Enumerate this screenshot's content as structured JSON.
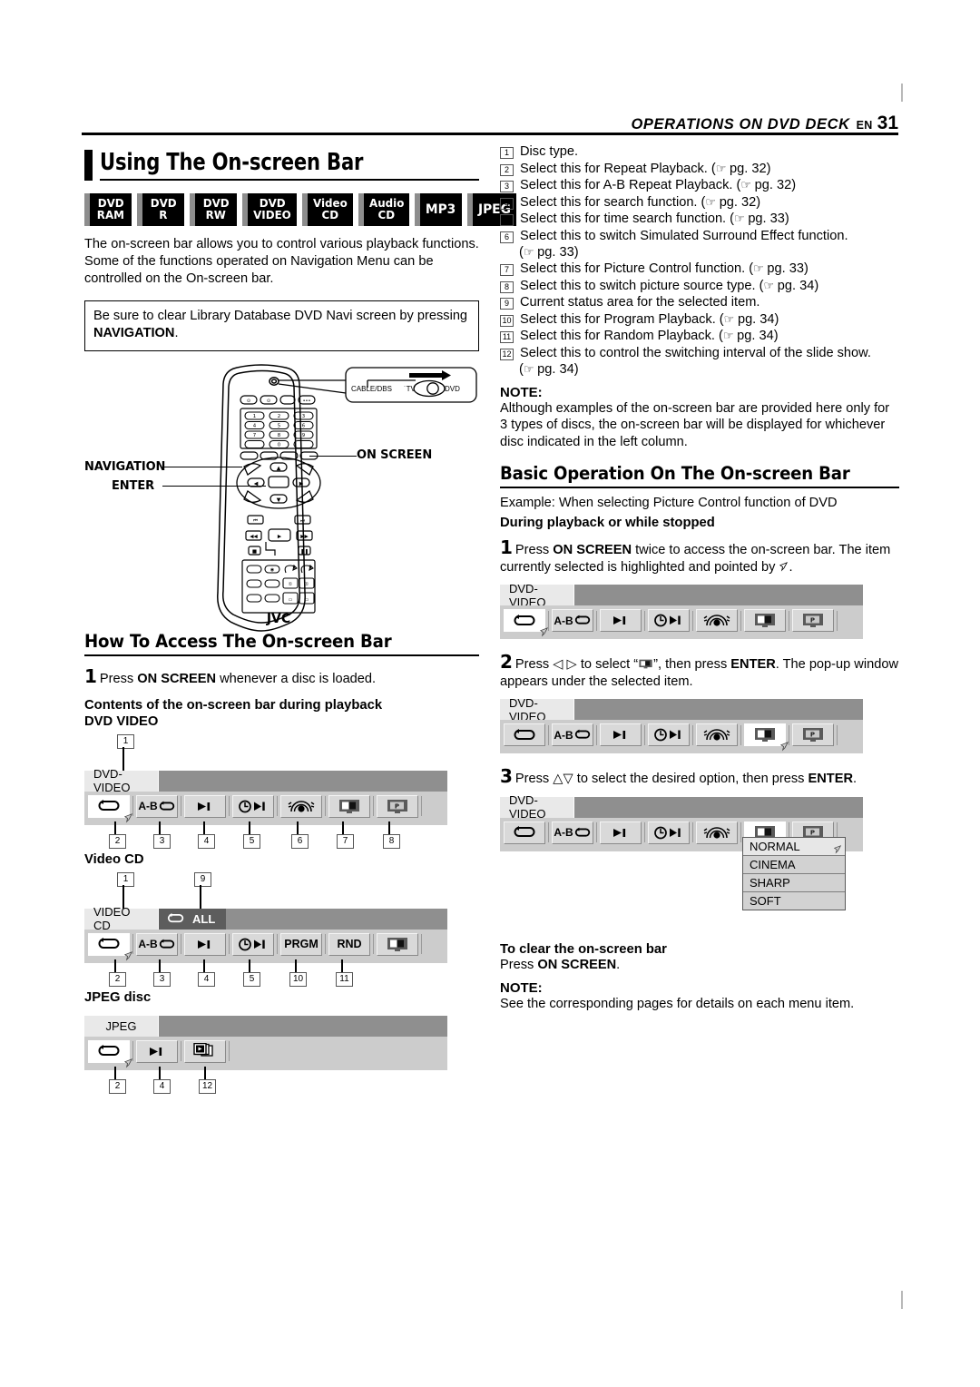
{
  "header": {
    "running_title": "OPERATIONS ON DVD DECK",
    "en": "EN",
    "page_number": "31"
  },
  "left": {
    "title": "Using The On-screen Bar",
    "disc_badges": [
      {
        "line1": "DVD",
        "line2": "RAM"
      },
      {
        "line1": "DVD",
        "line2": "R"
      },
      {
        "line1": "DVD",
        "line2": "RW"
      },
      {
        "line1": "DVD",
        "line2": "VIDEO"
      },
      {
        "line1": "Video",
        "line2": "CD"
      },
      {
        "line1": "Audio",
        "line2": "CD"
      },
      {
        "line1": "MP3",
        "line2": ""
      },
      {
        "line1": "JPEG",
        "line2": ""
      }
    ],
    "intro": "The on-screen bar allows you to control various playback functions. Some of the functions operated on Navigation Menu can be controlled on the On-screen bar.",
    "notebox_text": "Be sure to clear Library Database DVD Navi screen by pressing ",
    "notebox_bold": "NAVIGATION",
    "notebox_end": ".",
    "remote": {
      "label_navigation": "NAVIGATION",
      "label_enter": "ENTER",
      "label_onscreen": "ON SCREEN",
      "switch_cable": "CABLE/DBS",
      "switch_tv": "TV",
      "switch_dvd": "DVD",
      "brand": "JVC",
      "keypad": [
        "1",
        "2",
        "3",
        "4",
        "5",
        "6",
        "7",
        "8",
        "9",
        "0"
      ]
    },
    "how_to_access_title": "How To Access The On-screen Bar",
    "step1_num": "1",
    "step1_pre": "Press ",
    "step1_bold": "ON SCREEN",
    "step1_post": " whenever a disc is loaded.",
    "contents_heading": "Contents of the on-screen bar during playback",
    "dvd_video_label": "DVD VIDEO",
    "video_cd_label": "Video CD",
    "jpeg_label": "JPEG disc",
    "bars": {
      "dvd_video": {
        "tab": "DVD-VIDEO",
        "status": "",
        "buttons": [
          "repeat-icon",
          "ab-repeat-icon",
          "search-icon",
          "time-search-icon",
          "surround-icon",
          "picture-control-icon",
          "source-type-icon"
        ],
        "top_callouts": [
          "1"
        ],
        "bottom_callouts": [
          "2",
          "3",
          "4",
          "5",
          "6",
          "7",
          "8"
        ]
      },
      "video_cd": {
        "tab": "VIDEO CD",
        "status_chip": "ALL",
        "buttons": [
          "repeat-icon",
          "ab-repeat-icon",
          "search-icon",
          "time-search-icon",
          "PRGM",
          "RND",
          "picture-control-icon"
        ],
        "top_callouts": [
          "1",
          "9"
        ],
        "bottom_callouts": [
          "2",
          "3",
          "4",
          "5",
          "10",
          "11"
        ]
      },
      "jpeg": {
        "tab": "JPEG",
        "status": "",
        "buttons": [
          "repeat-icon",
          "search-icon",
          "slideshow-icon"
        ],
        "bottom_callouts": [
          "2",
          "4",
          "12"
        ]
      }
    }
  },
  "right": {
    "numbered_items": [
      {
        "n": "1",
        "text": "Disc type.",
        "pg": ""
      },
      {
        "n": "2",
        "text": "Select this for Repeat Playback. (",
        "pg": "pg. 32)"
      },
      {
        "n": "3",
        "text": "Select this for A-B Repeat Playback. (",
        "pg": "pg. 32)"
      },
      {
        "n": "4",
        "text": "Select this for search function. (",
        "pg": "pg. 32)"
      },
      {
        "n": "5",
        "text": "Select this for time search function. (",
        "pg": "pg. 33)"
      },
      {
        "n": "6",
        "text": "Select this to switch Simulated Surround Effect function.",
        "pg": "",
        "cont_pre": "(",
        "cont_pg": "pg. 33)"
      },
      {
        "n": "7",
        "text": "Select this for Picture Control function. (",
        "pg": "pg. 33)"
      },
      {
        "n": "8",
        "text": "Select this to switch picture source type. (",
        "pg": "pg. 34)"
      },
      {
        "n": "9",
        "text": "Current status area for the selected item.",
        "pg": ""
      },
      {
        "n": "10",
        "text": "Select this for Program Playback. (",
        "pg": "pg. 34)"
      },
      {
        "n": "11",
        "text": "Select this for Random Playback. (",
        "pg": "pg. 34)"
      },
      {
        "n": "12",
        "text": "Select this to control the switching interval of the slide show.",
        "pg": "",
        "cont_pre": "(",
        "cont_pg": "pg. 34)"
      }
    ],
    "note_label": "NOTE:",
    "note_text": "Although examples of the on-screen bar are provided here only for 3 types of discs, the on-screen bar will be displayed for whichever disc indicated in the left column.",
    "basic_op_title": "Basic Operation On The On-screen Bar",
    "example_text": "Example: When selecting Picture Control function of DVD",
    "during_playback": "During playback or while stopped",
    "step1": {
      "num": "1",
      "pre": "Press ",
      "bold": "ON SCREEN",
      "post": " twice to access the on-screen bar. The item currently selected is highlighted and pointed by ",
      "end": "."
    },
    "step2": {
      "num": "2",
      "pre": "Press ",
      "arrows": "◁ ▷",
      "mid": " to select “",
      "mid2": "”, then press ",
      "bold": "ENTER",
      "post": ". The pop-up window appears under the selected item."
    },
    "step3": {
      "num": "3",
      "pre": "Press ",
      "arrows": "△▽",
      "mid": " to select the desired option, then press ",
      "bold": "ENTER",
      "post": "."
    },
    "bars": {
      "step1_bar": {
        "tab": "DVD-VIDEO",
        "selected_index": 0
      },
      "step2_bar": {
        "tab": "DVD-VIDEO",
        "selected_index": 5
      },
      "step3_bar": {
        "tab": "DVD-VIDEO",
        "selected_index": 5
      }
    },
    "popup_options": [
      "NORMAL",
      "CINEMA",
      "SHARP",
      "SOFT"
    ],
    "clear_heading": "To clear the on-screen bar",
    "clear_pre": "Press ",
    "clear_bold": "ON SCREEN",
    "clear_post": ".",
    "note2_label": "NOTE:",
    "note2_text": "See the corresponding pages for details on each menu item."
  },
  "colors": {
    "bar_top": "#8f8f8f",
    "bar_row": "#cccccc",
    "tab": "#e9e9e9",
    "chip": "#5d5d5d",
    "button": "#d9d9d9",
    "selected": "#ffffff",
    "badge": "#000000",
    "spine": "#8d8d8d"
  }
}
